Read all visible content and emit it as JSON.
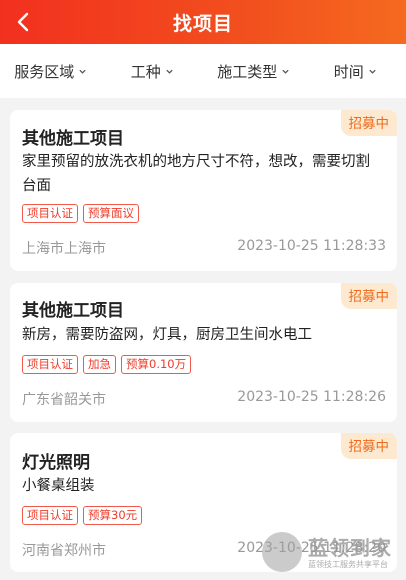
{
  "header": {
    "title": "找项目"
  },
  "filters": [
    {
      "label": "服务区域"
    },
    {
      "label": "工种"
    },
    {
      "label": "施工类型"
    },
    {
      "label": "时间"
    }
  ],
  "projects": [
    {
      "status": "招募中",
      "title": "其他施工项目",
      "description": "家里预留的放洗衣机的地方尺寸不符，想改，需要切割台面",
      "tags": [
        "项目认证",
        "预算面议"
      ],
      "location": "上海市上海市",
      "time": "2023-10-25 11:28:33"
    },
    {
      "status": "招募中",
      "title": "其他施工项目",
      "description": "新房，需要防盗网，灯具，厨房卫生间水电工",
      "tags": [
        "项目认证",
        "加急",
        "预算0.10万"
      ],
      "location": "广东省韶关市",
      "time": "2023-10-25 11:28:26"
    },
    {
      "status": "招募中",
      "title": "灯光照明",
      "description": "小餐桌组装",
      "tags": [
        "项目认证",
        "预算30元"
      ],
      "location": "河南省郑州市",
      "time": "2023-10-25 11:28:20"
    }
  ],
  "watermark": {
    "name": "蓝领到家",
    "subtitle": "蓝领技工服务共享平台"
  }
}
